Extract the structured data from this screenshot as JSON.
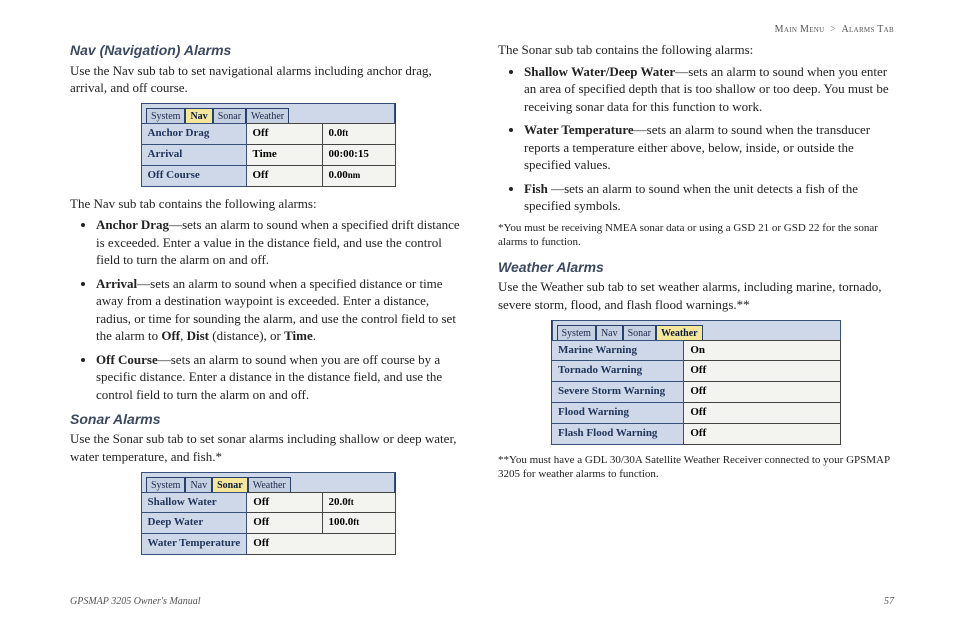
{
  "breadcrumb": {
    "a": "Main Menu",
    "sep": ">",
    "b": "Alarms Tab"
  },
  "colL": {
    "h1": "Nav (Navigation) Alarms",
    "p1": "Use the Nav sub tab to set navigational alarms including anchor drag, arrival, and off course.",
    "navTabs": {
      "t0": "System",
      "t1": "Nav",
      "t2": "Sonar",
      "t3": "Weather",
      "active": "t1"
    },
    "navTable": {
      "r0": {
        "label": "Anchor Drag",
        "v1": "Off",
        "v2": "0.0",
        "u2": "ft"
      },
      "r1": {
        "label": "Arrival",
        "v1": "Time",
        "v2": "00:00:15",
        "u2": ""
      },
      "r2": {
        "label": "Off Course",
        "v1": "Off",
        "v2": "0.00",
        "u2": "nm"
      }
    },
    "p2": "The Nav sub tab contains the following alarms:",
    "bul": {
      "b0": {
        "lead": "Anchor Drag",
        "text": "—sets an alarm to sound when a specified drift distance is exceeded. Enter a value in the distance field, and use the control field to turn the alarm on and off."
      },
      "b1": {
        "lead": "Arrival",
        "text": "—sets an alarm to sound when a specified distance or time away from a destination waypoint is exceeded. Enter a distance, radius, or time for sounding the alarm, and use the control field to set the alarm to ",
        "opt1": "Off",
        "opt2": "Dist",
        "opt2q": " (distance), or ",
        "opt3": "Time",
        "end": "."
      },
      "b2": {
        "lead": "Off Course",
        "text": "—sets an alarm to sound when you are off course by a specific distance. Enter a distance in the distance field, and use the control field to turn the alarm on and off."
      }
    },
    "h2": "Sonar Alarms",
    "p3": "Use the Sonar sub tab to set sonar alarms including shallow or deep water, water temperature, and fish.*",
    "sonarTabs": {
      "t0": "System",
      "t1": "Nav",
      "t2": "Sonar",
      "t3": "Weather",
      "active": "t2"
    },
    "sonarTable": {
      "r0": {
        "label": "Shallow Water",
        "v1": "Off",
        "v2": "20.0",
        "u2": "ft"
      },
      "r1": {
        "label": "Deep Water",
        "v1": "Off",
        "v2": "100.0",
        "u2": "ft"
      },
      "r2": {
        "label": "Water Temperature",
        "v1": "Off"
      }
    }
  },
  "colR": {
    "p1": "The Sonar sub tab contains the following alarms:",
    "bul": {
      "b0": {
        "lead": "Shallow Water/Deep Water",
        "text": "—sets an alarm to sound when you enter an area of specified depth that is too shallow or too deep. You must be receiving sonar data for this function to work."
      },
      "b1": {
        "lead": "Water Temperature",
        "text": "—sets an alarm to sound when the transducer reports a temperature either above, below, inside, or outside the specified values."
      },
      "b2": {
        "lead": "Fish ",
        "text": "—sets an alarm to sound when the unit detects a fish of the specified symbols."
      }
    },
    "note1": "*You must be receiving NMEA sonar data or using a GSD 21 or GSD 22 for the sonar alarms to function.",
    "h1": "Weather Alarms",
    "p2": "Use the Weather sub tab to set weather alarms, including marine, tornado, severe storm, flood, and flash flood warnings.**",
    "wxTabs": {
      "t0": "System",
      "t1": "Nav",
      "t2": "Sonar",
      "t3": "Weather",
      "active": "t3"
    },
    "wxTable": {
      "r0": {
        "label": "Marine Warning",
        "v": "On"
      },
      "r1": {
        "label": "Tornado Warning",
        "v": "Off"
      },
      "r2": {
        "label": "Severe Storm Warning",
        "v": "Off"
      },
      "r3": {
        "label": "Flood Warning",
        "v": "Off"
      },
      "r4": {
        "label": "Flash Flood Warning",
        "v": "Off"
      }
    },
    "note2": "**You must have a GDL 30/30A Satellite Weather Receiver connected to your GPSMAP 3205 for weather alarms to function."
  },
  "footer": {
    "left": "GPSMAP 3205 Owner's Manual",
    "right": "57"
  }
}
